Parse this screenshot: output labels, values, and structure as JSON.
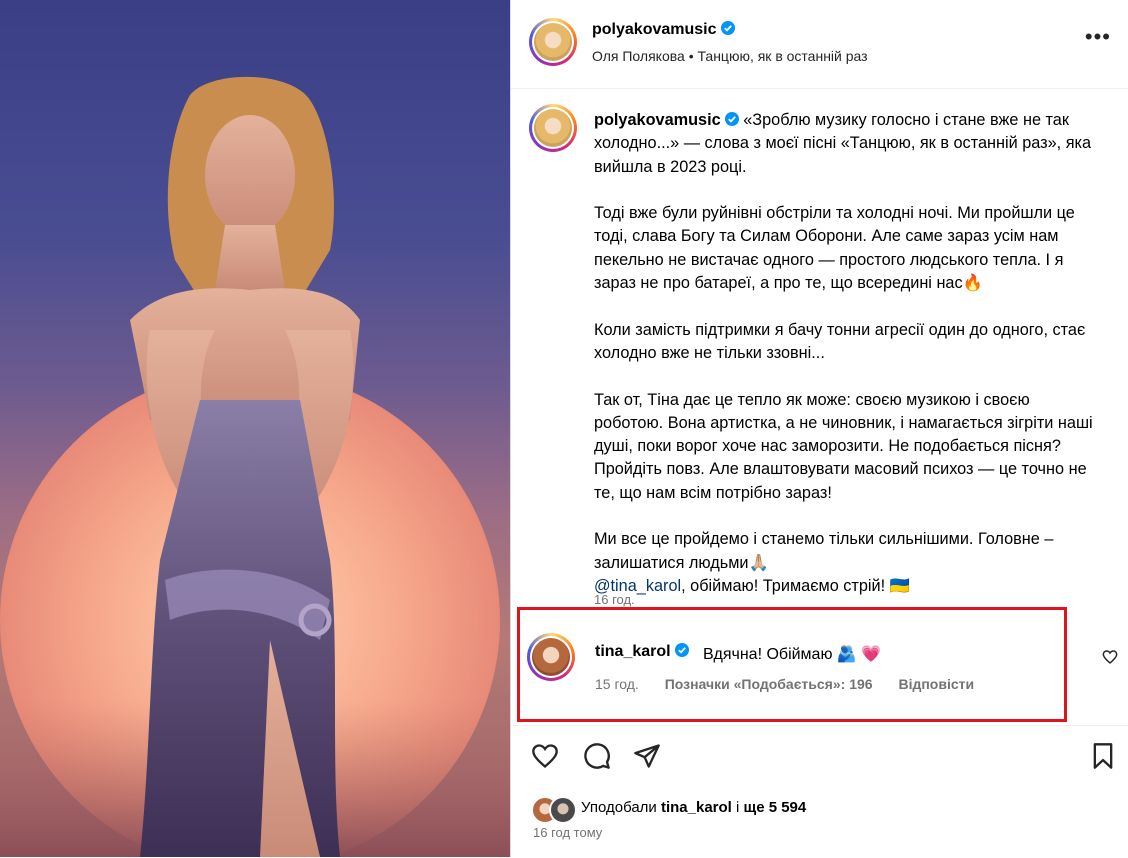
{
  "post": {
    "username": "polyakovamusic",
    "subtitle": "Оля Полякова • Танцюю, як в останній раз",
    "more_label": "•••"
  },
  "caption": {
    "username": "polyakovamusic",
    "p1": "«Зроблю музику голосно і стане вже не так холодно...» — слова з моєї пісні «Танцюю, як в останній раз», яка вийшла в 2023 році.",
    "p2": "Тоді вже були руйнівні обстріли та холодні ночі. Ми пройшли це тоді, слава Богу та Силам Оборони. Але саме зараз усім нам пекельно не вистачає одного — простого людського тепла. І я зараз не про батареї, а про те, що всередині нас🔥",
    "p3": "Коли замість підтримки я бачу тонни агресії один до одного, стає холодно вже не тільки ззовні...",
    "p4": "Так от, Тіна дає це тепло як може: своєю музикою і своєю роботою. Вона артистка, а не чиновник, і намагається зігріти наші душі, поки ворог хоче нас заморозити. Не подобається пісня? Пройдіть повз. Але влаштовувати масовий психоз — це точно не те, що нам всім потрібно зараз!",
    "p5a": "Ми все це пройдемо і станемо тільки сильнішими. Головне – залишатися людьми🙏🏼",
    "mention": "@tina_karol",
    "p5b": ", обіймаю! Тримаємо стрій! 🇺🇦",
    "time": "16 год."
  },
  "comment": {
    "username": "tina_karol",
    "text": "Вдячна! Обіймаю 🫂 💗",
    "time": "15 год.",
    "likes": "Позначки «Подобається»: 196",
    "reply": "Відповісти"
  },
  "footer": {
    "liked_prefix": "Уподобали ",
    "liked_user": "tina_karol",
    "liked_mid": " і ",
    "liked_rest": "ще 5 594",
    "time_ago": "16 год тому"
  },
  "colors": {
    "verified": "#0095f6",
    "highlight_border": "#e0141d",
    "mention": "#00376b",
    "meta": "#737373"
  },
  "icons": [
    "verified-icon",
    "more-icon",
    "heart-icon",
    "comment-icon",
    "share-icon",
    "save-icon",
    "comment-like-icon"
  ]
}
